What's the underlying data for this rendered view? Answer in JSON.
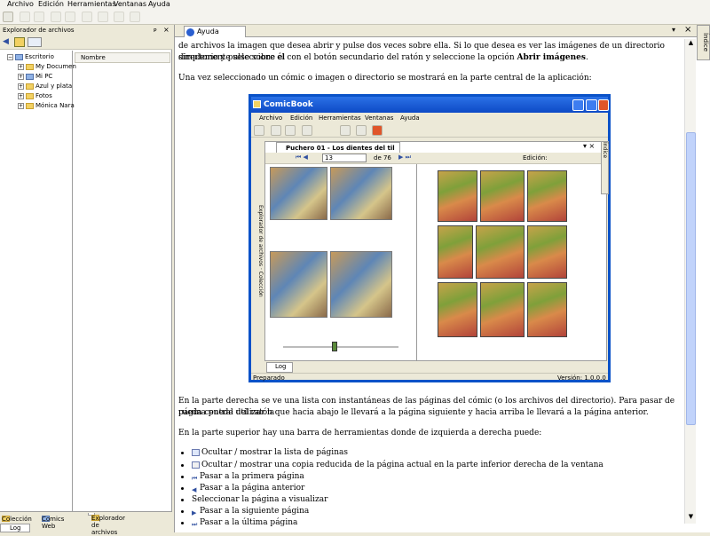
{
  "menu": [
    "Archivo",
    "Edición",
    "Herramientas",
    "Ventanas",
    "Ayuda"
  ],
  "left_panel": {
    "title": "Explorador de archivos",
    "tree": [
      {
        "label": "Escritorio",
        "expanded": true
      },
      {
        "label": "My Documen"
      },
      {
        "label": "Mi PC"
      },
      {
        "label": "Azul y plata"
      },
      {
        "label": "Fotos"
      },
      {
        "label": "Mónica Nara"
      }
    ],
    "column_header": "Nombre",
    "tabs": [
      "Colección",
      "Comics Web",
      "Explorador de archivos"
    ],
    "log_label": "Log"
  },
  "help": {
    "tab_label": "Ayuda",
    "index_label": "Índice",
    "paragraphs": {
      "p1_line1": "de archivos la imagen que desea abrir y pulse dos veces sobre ella. Si lo que desea es ver las imágenes de un directorio simplemente seleccione el",
      "p1_line2_pre": "directorio y pulse sobre él con el botón secundario del ratón y seleccione la opción ",
      "p1_line2_bold": "Abrir imágenes",
      "p1_line2_post": ".",
      "p2": "Una vez seleccionado un cómic o imagen o directorio se mostrará en la parte central de la aplicación:",
      "p3_line1": "En la parte derecha se ve una lista con instantáneas de las páginas del cómic (o los archivos del directorio). Para pasar de página puede utilizar la",
      "p3_line2": "rueda central del ratón que hacia abajo le llevará a la página siguiente y hacia arriba le llevará a la página anterior.",
      "p4": "En la parte superior hay una barra de herramientas donde de izquierda a derecha puede:"
    },
    "bullets": [
      "Ocultar / mostrar la lista de páginas",
      "Ocultar / mostrar una copia reducida de la página actual en la parte inferior derecha de la ventana",
      "Pasar a la primera página",
      "Pasar a la página anterior",
      "Seleccionar la página a visualizar",
      "Pasar a la siguiente página",
      "Pasar a la última página"
    ]
  },
  "screenshot": {
    "title": "ComicBook",
    "menu": [
      "Archivo",
      "Edición",
      "Herramientas",
      "Ventanas",
      "Ayuda"
    ],
    "doc_tab": "Puchero 01 - Los dientes del til",
    "page_value": "13",
    "page_total": "de 76",
    "edition_label": "Edición:",
    "side_tabs": [
      "Explorador de archivos",
      "Colección"
    ],
    "right_tab": "Índice",
    "log_label": "Log",
    "status": "Preparado",
    "version": "Versión: 1.0.0.0"
  }
}
